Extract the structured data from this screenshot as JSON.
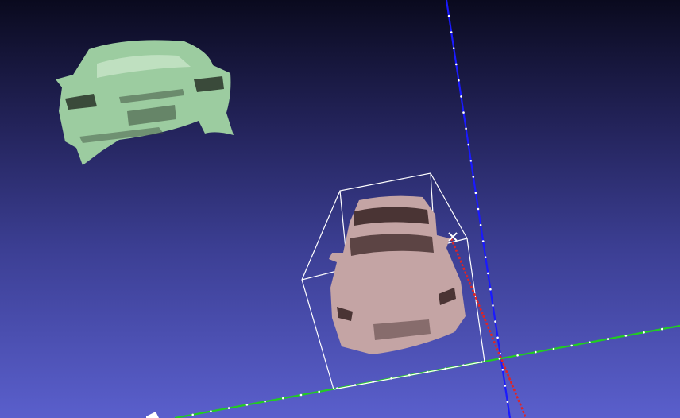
{
  "viewport": {
    "background_top": "#0a0a1e",
    "background_bottom": "#5a5fcc"
  },
  "axes": {
    "x_color": "#e02424",
    "y_color": "#22cc22",
    "z_color": "#1a1aff",
    "tick_color": "#ffffff"
  },
  "meshes": [
    {
      "name": "reference-car-mesh",
      "color": "#9ccca0"
    },
    {
      "name": "selected-car-mesh",
      "color": "#c4a4a4"
    }
  ],
  "selection": {
    "bbox_color": "#ffffff",
    "pivot_marker_icon": "x-mark-icon"
  }
}
